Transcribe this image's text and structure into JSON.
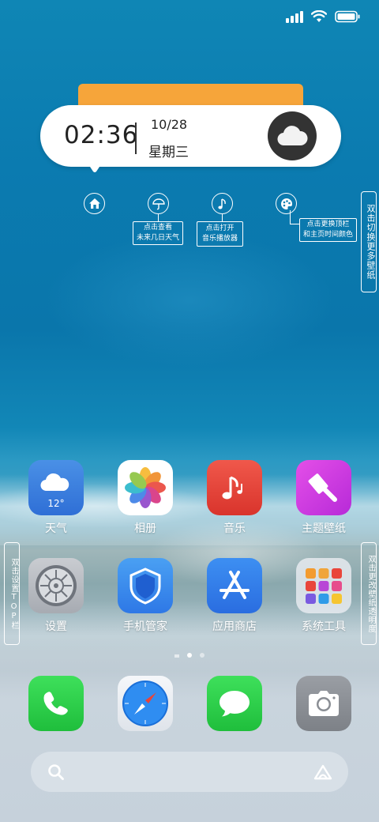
{
  "status_bar": {
    "signal_icon": "cellular-signal-icon",
    "wifi_icon": "wifi-icon",
    "battery_icon": "battery-icon"
  },
  "clock_widget": {
    "time": "02:36",
    "date": "10/28",
    "weekday": "星期三",
    "weather_icon": "cloud-icon",
    "accent_color": "#f6a53a"
  },
  "hints": {
    "home_icon": "home-icon",
    "weather": {
      "icon": "umbrella-icon",
      "lines": [
        "点击查看",
        "未来几日天气"
      ]
    },
    "music": {
      "icon": "music-note-icon",
      "lines": [
        "点击打开",
        "音乐播放器"
      ]
    },
    "theme": {
      "icon": "palette-icon",
      "lines": [
        "点击更换顶栏",
        "和主页时间颜色"
      ]
    },
    "switch_wallpaper": "双击切换更多壁纸",
    "set_topbar": "双击设置TOP栏",
    "change_transparency": "双击更改壁纸透明度"
  },
  "apps": [
    {
      "label": "天气",
      "icon": "weather-icon",
      "temp": "12°"
    },
    {
      "label": "相册",
      "icon": "photos-icon"
    },
    {
      "label": "音乐",
      "icon": "music-icon"
    },
    {
      "label": "主题壁纸",
      "icon": "theme-brush-icon"
    },
    {
      "label": "设置",
      "icon": "settings-gear-icon"
    },
    {
      "label": "手机管家",
      "icon": "phone-manager-shield-icon"
    },
    {
      "label": "应用商店",
      "icon": "app-store-icon"
    },
    {
      "label": "系统工具",
      "icon": "system-tools-folder-icon"
    }
  ],
  "page_indicator": {
    "pages": 2,
    "current": 1
  },
  "dock": [
    {
      "name": "phone",
      "icon": "phone-icon"
    },
    {
      "name": "browser",
      "icon": "compass-icon"
    },
    {
      "name": "messages",
      "icon": "message-icon"
    },
    {
      "name": "camera",
      "icon": "camera-icon"
    }
  ],
  "search_bar": {
    "search_icon": "search-icon",
    "assistant_icon": "assistant-icon"
  }
}
